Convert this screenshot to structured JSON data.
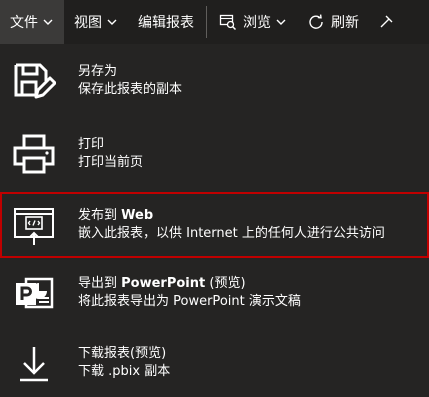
{
  "toolbar": {
    "file_label": "文件",
    "view_label": "视图",
    "edit_label": "编辑报表",
    "browse_label": "浏览",
    "refresh_label": "刷新"
  },
  "menu": {
    "items": [
      {
        "title": "另存为",
        "desc": "保存此报表的副本"
      },
      {
        "title": "打印",
        "desc": "打印当前页"
      },
      {
        "title_prefix": "发布到 ",
        "title_bold": "Web",
        "desc": "嵌入此报表，以供 Internet 上的任何人进行公共访问"
      },
      {
        "title_prefix": "导出到 ",
        "title_bold": "PowerPoint",
        "title_suffix": " (预览)",
        "desc": "将此报表导出为 PowerPoint 演示文稿"
      },
      {
        "title": "下载报表(预览)",
        "desc": "下载 .pbix 副本"
      }
    ]
  },
  "colors": {
    "toolbar_bg": "#201f1e",
    "menu_bg": "#252423",
    "active_bg": "#3b3a39",
    "highlight_border": "#c00000",
    "text": "#ffffff"
  }
}
